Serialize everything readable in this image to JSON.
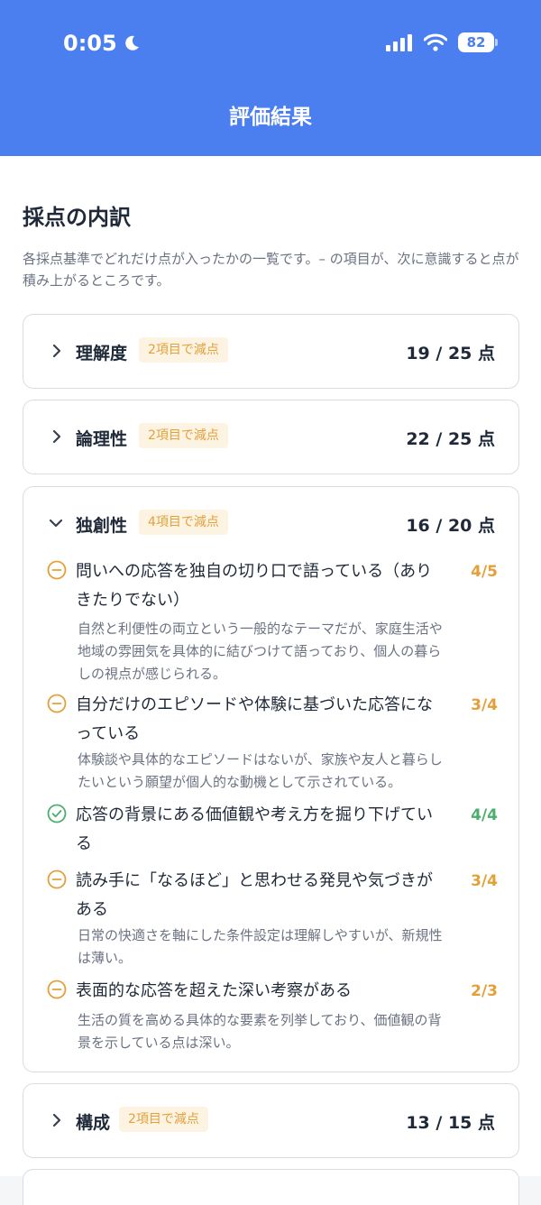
{
  "status_bar": {
    "time": "0:05",
    "battery": "82"
  },
  "header": {
    "title": "評価結果"
  },
  "section": {
    "title": "採点の内訳",
    "description": "各採点基準でどれだけ点が入ったかの一覧です。– の項目が、次に意識すると点が積み上がるところです。"
  },
  "colors": {
    "accent": "#4b7ff0",
    "warning": "#e3a039",
    "success": "#4bae6e",
    "badge_bg": "#fdf3e3"
  },
  "categories": [
    {
      "name": "理解度",
      "badge": "2項目で減点",
      "score": "19 / 25 点",
      "expanded": false
    },
    {
      "name": "論理性",
      "badge": "2項目で減点",
      "score": "22 / 25 点",
      "expanded": false
    },
    {
      "name": "独創性",
      "badge": "4項目で減点",
      "score": "16 / 20 点",
      "expanded": true,
      "criteria": [
        {
          "title_lines": [
            "問いへの応答を独自の切り口で語っている（あり",
            "きたりでない）"
          ],
          "score": "4/5",
          "status": "minus",
          "note_lines": [
            "自然と利便性の両立という一般的なテーマだが、家庭生活や",
            "地域の雰囲気を具体的に結びつけて語っており、個人の暮ら",
            "しの視点が感じられる。"
          ]
        },
        {
          "title_lines": [
            "自分だけのエピソードや体験に基づいた応答にな",
            "っている"
          ],
          "score": "3/4",
          "status": "minus",
          "note_lines": [
            "体験談や具体的なエピソードはないが、家族や友人と暮らし",
            "たいという願望が個人的な動機として示されている。"
          ]
        },
        {
          "title_lines": [
            "応答の背景にある価値観や考え方を掘り下げてい",
            "る"
          ],
          "score": "4/4",
          "status": "check",
          "note_lines": []
        },
        {
          "title_lines": [
            "読み手に「なるほど」と思わせる発見や気づきが",
            "ある"
          ],
          "score": "3/4",
          "status": "minus",
          "note_lines": [
            "日常の快適さを軸にした条件設定は理解しやすいが、新規性",
            "は薄い。"
          ]
        },
        {
          "title_lines": [
            "表面的な応答を超えた深い考察がある"
          ],
          "score": "2/3",
          "status": "minus",
          "note_lines": [
            "生活の質を高める具体的な要素を列挙しており、価値観の背",
            "景を示している点は深い。"
          ]
        }
      ]
    },
    {
      "name": "構成",
      "badge": "2項目で減点",
      "score": "13 / 15 点",
      "expanded": false
    }
  ]
}
